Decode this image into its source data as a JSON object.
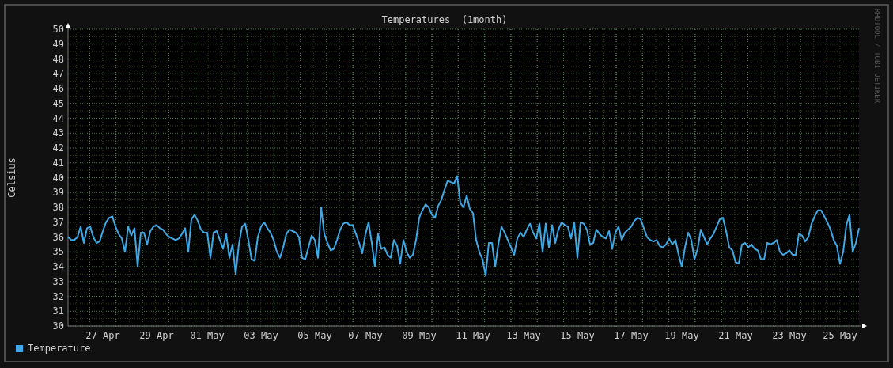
{
  "graph": {
    "credit": "RRDTOOL / TOBI OETIKER",
    "chart_data": {
      "type": "line",
      "title": "Temperatures  (1month)",
      "ylabel": "Celsius",
      "grid": true,
      "ylim": [
        30,
        50
      ],
      "yticks": [
        30,
        31,
        32,
        33,
        34,
        35,
        36,
        37,
        38,
        39,
        40,
        41,
        42,
        43,
        44,
        45,
        46,
        47,
        48,
        49,
        50
      ],
      "categories": [
        null,
        null,
        null,
        null,
        null,
        null,
        null,
        null,
        null,
        null,
        null,
        "27 Apr",
        null,
        null,
        null,
        null,
        null,
        null,
        null,
        null,
        null,
        null,
        null,
        null,
        null,
        null,
        null,
        null,
        "29 Apr",
        null,
        null,
        null,
        null,
        null,
        null,
        null,
        null,
        null,
        null,
        null,
        null,
        null,
        null,
        null,
        "01 May",
        null,
        null,
        null,
        null,
        null,
        null,
        null,
        null,
        null,
        null,
        null,
        null,
        null,
        null,
        null,
        null,
        "03 May",
        null,
        null,
        null,
        null,
        null,
        null,
        null,
        null,
        null,
        null,
        null,
        null,
        null,
        null,
        null,
        null,
        "05 May",
        null,
        null,
        null,
        null,
        null,
        null,
        null,
        null,
        null,
        null,
        null,
        null,
        null,
        null,
        null,
        "07 May",
        null,
        null,
        null,
        null,
        null,
        null,
        null,
        null,
        null,
        null,
        null,
        null,
        null,
        null,
        null,
        null,
        "09 May",
        null,
        null,
        null,
        null,
        null,
        null,
        null,
        null,
        null,
        null,
        null,
        null,
        null,
        null,
        null,
        null,
        "11 May",
        null,
        null,
        null,
        null,
        null,
        null,
        null,
        null,
        null,
        null,
        null,
        null,
        null,
        null,
        null,
        "13 May",
        null,
        null,
        null,
        null,
        null,
        null,
        null,
        null,
        null,
        null,
        null,
        null,
        null,
        null,
        null,
        null,
        "15 May",
        null,
        null,
        null,
        null,
        null,
        null,
        null,
        null,
        null,
        null,
        null,
        null,
        null,
        null,
        null,
        null,
        "17 May",
        null,
        null,
        null,
        null,
        null,
        null,
        null,
        null,
        null,
        null,
        null,
        null,
        null,
        null,
        null,
        "19 May",
        null,
        null,
        null,
        null,
        null,
        null,
        null,
        null,
        null,
        null,
        null,
        null,
        null,
        null,
        null,
        null,
        "21 May",
        null,
        null,
        null,
        null,
        null,
        null,
        null,
        null,
        null,
        null,
        null,
        null,
        null,
        null,
        null,
        null,
        "23 May",
        null,
        null,
        null,
        null,
        null,
        null,
        null,
        null,
        null,
        null,
        null,
        null,
        null,
        null,
        null,
        "25 May",
        null,
        null,
        null,
        null,
        null,
        null
      ],
      "series": [
        {
          "name": "Temperature",
          "color": "#3ea9e6",
          "values": [
            36.0,
            35.8,
            35.8,
            36.0,
            36.7,
            35.6,
            36.6,
            36.7,
            36.0,
            35.6,
            35.7,
            36.4,
            37.0,
            37.3,
            37.4,
            36.7,
            36.2,
            35.9,
            35.0,
            36.7,
            36.1,
            36.6,
            34.0,
            36.3,
            36.3,
            35.5,
            36.4,
            36.7,
            36.8,
            36.6,
            36.5,
            36.2,
            36.0,
            35.9,
            35.8,
            35.9,
            36.2,
            36.6,
            35.0,
            37.2,
            37.5,
            37.1,
            36.5,
            36.3,
            36.3,
            34.6,
            36.3,
            36.4,
            35.8,
            35.2,
            36.2,
            34.6,
            35.5,
            33.5,
            35.5,
            36.7,
            36.9,
            35.8,
            34.5,
            34.4,
            36.0,
            36.7,
            37.0,
            36.6,
            36.3,
            35.8,
            35.0,
            34.6,
            35.3,
            36.2,
            36.5,
            36.4,
            36.3,
            36.0,
            34.6,
            34.5,
            35.3,
            36.1,
            35.8,
            34.6,
            38.0,
            36.2,
            35.6,
            35.1,
            35.2,
            35.8,
            36.5,
            36.9,
            37.0,
            36.8,
            36.8,
            36.2,
            35.6,
            34.9,
            36.2,
            37.0,
            35.6,
            34.0,
            36.2,
            35.2,
            35.3,
            34.8,
            34.6,
            35.8,
            35.4,
            34.2,
            35.8,
            35.0,
            34.6,
            34.8,
            35.8,
            37.3,
            37.8,
            38.2,
            38.0,
            37.5,
            37.3,
            38.1,
            38.5,
            39.2,
            39.8,
            39.7,
            39.6,
            40.1,
            38.3,
            38.0,
            38.8,
            37.9,
            37.6,
            35.8,
            35.0,
            34.5,
            33.4,
            35.6,
            35.6,
            34.0,
            35.5,
            36.7,
            36.3,
            35.8,
            35.3,
            34.8,
            35.9,
            36.3,
            36.0,
            36.5,
            36.9,
            36.3,
            35.9,
            36.9,
            35.0,
            36.9,
            35.3,
            36.8,
            35.6,
            36.5,
            37.0,
            36.8,
            36.7,
            35.9,
            37.0,
            34.6,
            37.0,
            36.9,
            36.5,
            35.5,
            35.6,
            36.5,
            36.2,
            36.0,
            35.9,
            36.4,
            35.2,
            36.3,
            36.7,
            35.8,
            36.3,
            36.5,
            36.7,
            37.1,
            37.3,
            37.2,
            36.6,
            36.0,
            35.8,
            35.7,
            35.8,
            35.4,
            35.3,
            35.5,
            35.9,
            35.5,
            35.8,
            34.8,
            34.0,
            35.3,
            36.3,
            35.8,
            34.5,
            35.2,
            36.5,
            36.0,
            35.5,
            35.9,
            36.2,
            36.7,
            37.2,
            37.3,
            36.4,
            35.3,
            35.1,
            34.3,
            34.2,
            35.5,
            35.6,
            35.3,
            35.5,
            35.2,
            35.1,
            34.5,
            34.5,
            35.6,
            35.5,
            35.6,
            35.8,
            35.0,
            34.8,
            34.9,
            35.1,
            34.8,
            34.8,
            36.2,
            36.1,
            35.7,
            36.0,
            36.9,
            37.4,
            37.8,
            37.8,
            37.4,
            37.0,
            36.5,
            35.8,
            35.4,
            34.2,
            35.0,
            36.8,
            37.5,
            35.0,
            35.6,
            36.6
          ]
        }
      ]
    }
  }
}
